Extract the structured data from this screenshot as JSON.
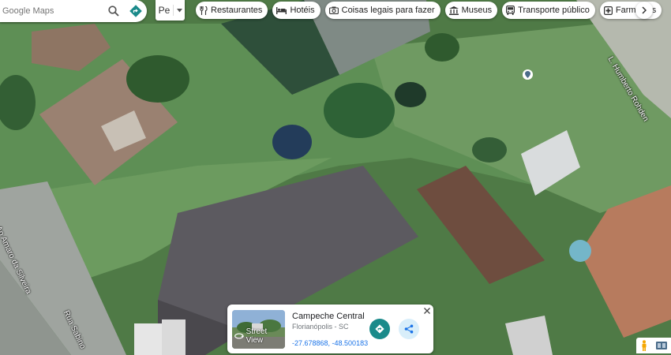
{
  "search": {
    "placeholder": "Google Maps"
  },
  "layer_select": {
    "value": "Pe"
  },
  "chips": [
    {
      "label": "Restaurantes",
      "icon": "fork-knife-icon"
    },
    {
      "label": "Hotéis",
      "icon": "bed-icon"
    },
    {
      "label": "Coisas legais para fazer",
      "icon": "camera-icon"
    },
    {
      "label": "Museus",
      "icon": "museum-icon"
    },
    {
      "label": "Transporte público",
      "icon": "bus-icon"
    },
    {
      "label": "Farmácias",
      "icon": "pharmacy-icon"
    }
  ],
  "roads": {
    "top_right": "L. Humberto Rohden",
    "left": "Ao Amaro da Silveira",
    "bottom_left": "Rua Sabino"
  },
  "card": {
    "title": "Campeche Central",
    "subtitle": "Florianópolis - SC",
    "coords": "-27.678868, -48.500183",
    "street_view": "Street View"
  },
  "colors": {
    "accent": "#1a8a8a",
    "link": "#1a73e8"
  }
}
